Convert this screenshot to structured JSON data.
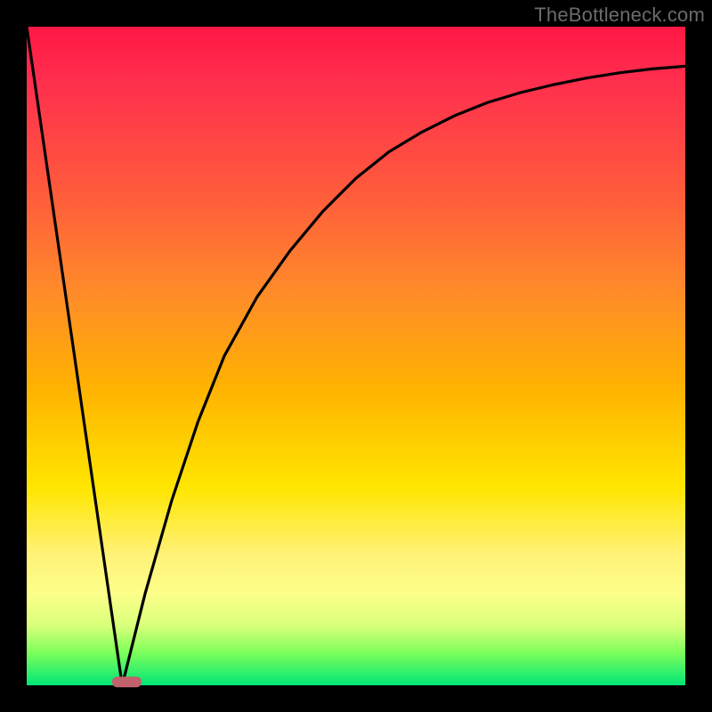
{
  "watermark": "TheBottleneck.com",
  "chart_data": {
    "type": "line",
    "title": "",
    "xlabel": "",
    "ylabel": "",
    "xlim": [
      0,
      100
    ],
    "ylim": [
      0,
      100
    ],
    "series": [
      {
        "name": "left-descent",
        "x": [
          0,
          14.5
        ],
        "values": [
          100,
          0
        ]
      },
      {
        "name": "right-curve",
        "x": [
          14.5,
          18,
          22,
          26,
          30,
          35,
          40,
          45,
          50,
          55,
          60,
          65,
          70,
          75,
          80,
          85,
          90,
          95,
          100
        ],
        "values": [
          0,
          14,
          28,
          40,
          50,
          59,
          66,
          72,
          77,
          81,
          84,
          86.5,
          88.5,
          90,
          91.2,
          92.2,
          93,
          93.6,
          94
        ]
      }
    ],
    "marker": {
      "name": "bottom-indicator",
      "x_center": 15.2,
      "y": 0.5,
      "width_x": 4.5,
      "color": "#c1616b"
    },
    "background_gradient": {
      "top": "#ff1744",
      "upper_mid": "#ff8a2a",
      "mid": "#ffe600",
      "lower_mid": "#fdff8a",
      "bottom": "#00e676"
    }
  }
}
